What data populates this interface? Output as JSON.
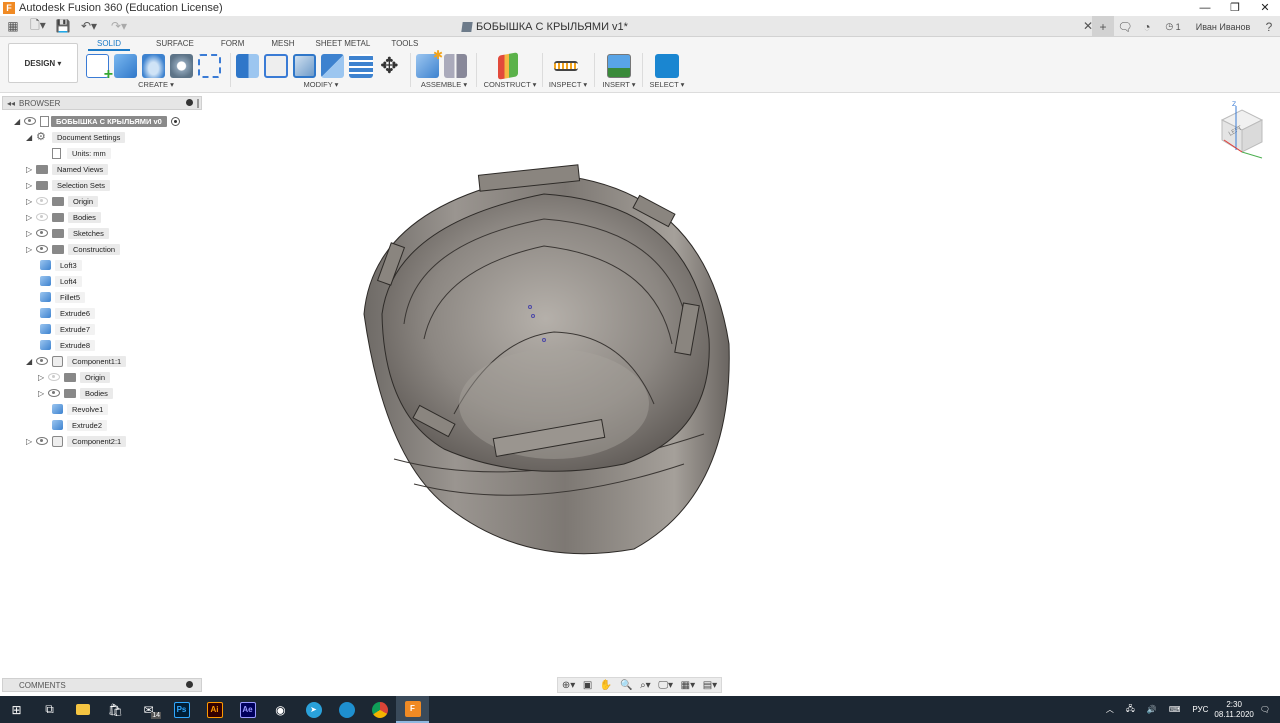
{
  "window": {
    "title": "Autodesk Fusion 360 (Education License)",
    "logo_letter": "F",
    "min": "—",
    "max": "❐",
    "close": "✕"
  },
  "qabar": {
    "doc_title": "БОБЫШКА С КРЫЛЬЯМИ v1*",
    "tab_close": "✕",
    "notifications": "1",
    "user": "Иван Иванов"
  },
  "ribbon": {
    "workspace": "DESIGN ▾",
    "tabs": [
      "SOLID",
      "SURFACE",
      "FORM",
      "MESH",
      "SHEET METAL",
      "TOOLS"
    ],
    "groups": {
      "create": "CREATE ▾",
      "modify": "MODIFY ▾",
      "assemble": "ASSEMBLE ▾",
      "construct": "CONSTRUCT ▾",
      "inspect": "INSPECT ▾",
      "insert": "INSERT ▾",
      "select": "SELECT ▾"
    },
    "move_glyph": "✥"
  },
  "browser": {
    "title": "BROWSER",
    "collapse_glyph": "◂◂",
    "items": [
      {
        "label": "БОБЫШКА С КРЫЛЬЯМИ v0"
      },
      {
        "label": "Document Settings"
      },
      {
        "label": "Units: mm"
      },
      {
        "label": "Named Views"
      },
      {
        "label": "Selection Sets"
      },
      {
        "label": "Origin"
      },
      {
        "label": "Bodies"
      },
      {
        "label": "Sketches"
      },
      {
        "label": "Construction"
      },
      {
        "label": "Loft3"
      },
      {
        "label": "Loft4"
      },
      {
        "label": "Fillet5"
      },
      {
        "label": "Extrude6"
      },
      {
        "label": "Extrude7"
      },
      {
        "label": "Extrude8"
      },
      {
        "label": "Component1:1"
      },
      {
        "label": "Origin"
      },
      {
        "label": "Bodies"
      },
      {
        "label": "Revolve1"
      },
      {
        "label": "Extrude2"
      },
      {
        "label": "Component2:1"
      }
    ]
  },
  "viewcube": {
    "face": "LEFT",
    "axis_z": "Z"
  },
  "comments": {
    "title": "COMMENTS"
  },
  "taskbar": {
    "badge_count": "14",
    "apps": {
      "ps": "Ps",
      "ai": "Ai",
      "ae": "Ae",
      "fusion": "F"
    },
    "language": "РУС",
    "time": "2:30",
    "date": "08.11.2020"
  },
  "colors": {
    "accent": "#1a7ac7",
    "select_active": "#1a86d1",
    "taskbar": "#1c2733"
  }
}
